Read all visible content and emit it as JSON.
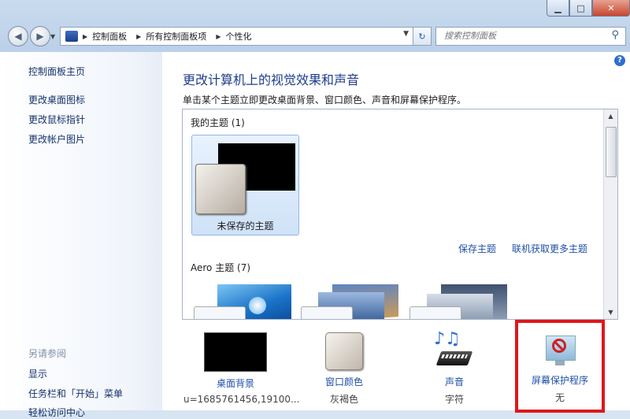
{
  "window": {
    "minimize": "▁",
    "maximize": "□",
    "close": "✕"
  },
  "address": {
    "root_icon": "control-panel-icon",
    "segments": [
      "控制面板",
      "所有控制面板项",
      "个性化"
    ]
  },
  "search": {
    "placeholder": "搜索控制面板"
  },
  "sidebar": {
    "items": [
      "控制面板主页",
      "更改桌面图标",
      "更改鼠标指针",
      "更改帐户图片"
    ],
    "see_also_title": "另请参阅",
    "see_also": [
      "显示",
      "任务栏和「开始」菜单",
      "轻松访问中心"
    ]
  },
  "main": {
    "title": "更改计算机上的视觉效果和声音",
    "subtitle": "单击某个主题立即更改桌面背景、窗口颜色、声音和屏幕保护程序。",
    "my_themes_label": "我的主题 (1)",
    "unsaved_theme": "未保存的主题",
    "save_theme": "保存主题",
    "get_more_online": "联机获取更多主题",
    "aero_label": "Aero 主题 (7)"
  },
  "bottom": [
    {
      "name": "桌面背景",
      "value": "u=1685761456,19100..."
    },
    {
      "name": "窗口颜色",
      "value": "灰褐色"
    },
    {
      "name": "声音",
      "value": "字符"
    },
    {
      "name": "屏幕保护程序",
      "value": "无"
    }
  ],
  "colors": {
    "highlight": "#e0161b",
    "link": "#1f4fa8",
    "title": "#1f3d8c"
  }
}
